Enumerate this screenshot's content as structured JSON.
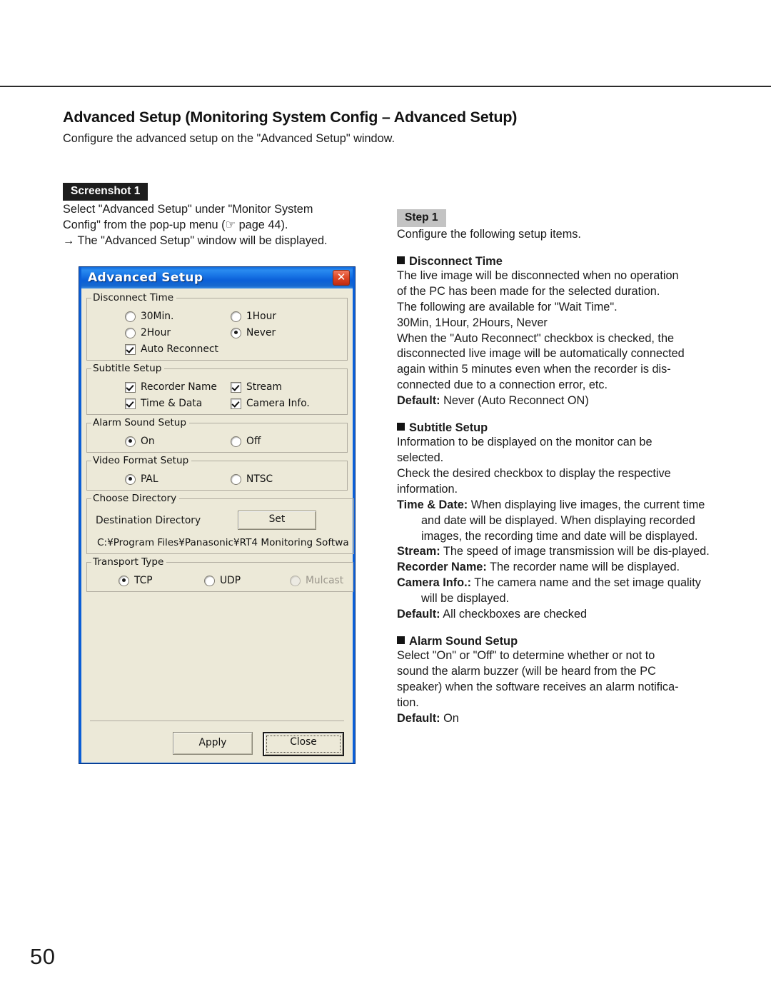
{
  "page": {
    "number": "50",
    "title": "Advanced Setup (Monitoring System Config – Advanced Setup)",
    "intro": "Configure the advanced setup on the \"Advanced Setup\" window."
  },
  "screenshot_section": {
    "badge": "Screenshot 1",
    "lines": [
      "Select \"Advanced Setup\" under \"Monitor System",
      "Config\" from the pop-up menu (☞ page 44).",
      "→ The \"Advanced Setup\" window will be displayed."
    ]
  },
  "step_section": {
    "badge": "Step 1",
    "intro": "Configure the following setup items.",
    "blocks": [
      {
        "heading": "Disconnect Time",
        "lines": [
          "The live image will be disconnected when no operation",
          "of the PC has been made for the selected duration.",
          "The following are available for \"Wait Time\".",
          "30Min, 1Hour, 2Hours, Never",
          "When the \"Auto Reconnect\" checkbox is checked, the",
          "disconnected live image will be automatically connected",
          "again within 5 minutes even when the recorder is dis-",
          "connected due to a connection error, etc."
        ],
        "default_label": "Default:",
        "default_value": "Never (Auto Reconnect ON)"
      },
      {
        "heading": "Subtitle Setup",
        "lines": [
          "Information to be displayed on the monitor can be",
          "selected.",
          "Check the desired checkbox to display the respective",
          "information."
        ],
        "definitions": [
          {
            "term": "Time & Date:",
            "text": "When displaying live images, the current time and date will be displayed. When displaying recorded images, the recording time and date will be displayed."
          },
          {
            "term": "Stream:",
            "text": "The speed of image transmission will be dis-played."
          },
          {
            "term": "Recorder Name:",
            "text": "The recorder name will be displayed."
          },
          {
            "term": "Camera Info.:",
            "text": "The camera name and the set image quality will be displayed."
          }
        ],
        "default_label": "Default:",
        "default_value": "All checkboxes are checked"
      },
      {
        "heading": "Alarm Sound Setup",
        "lines": [
          "Select \"On\" or \"Off\" to determine whether or not to",
          "sound the alarm buzzer (will be heard from the PC",
          "speaker) when the software receives an alarm notifica-",
          "tion."
        ],
        "default_label": "Default:",
        "default_value": "On"
      }
    ]
  },
  "dialog": {
    "title": "Advanced Setup",
    "close_icon": "✕",
    "groups": {
      "disconnect_time": {
        "legend": "Disconnect Time",
        "options": [
          {
            "label": "30Min.",
            "selected": false
          },
          {
            "label": "1Hour",
            "selected": false
          },
          {
            "label": "2Hour",
            "selected": false
          },
          {
            "label": "Never",
            "selected": true
          }
        ],
        "checkbox": {
          "label": "Auto Reconnect",
          "checked": true
        }
      },
      "subtitle_setup": {
        "legend": "Subtitle Setup",
        "checkboxes": [
          {
            "label": "Recorder Name",
            "checked": true
          },
          {
            "label": "Stream",
            "checked": true
          },
          {
            "label": "Time & Data",
            "checked": true
          },
          {
            "label": "Camera Info.",
            "checked": true
          }
        ]
      },
      "alarm_sound_setup": {
        "legend": "Alarm Sound Setup",
        "options": [
          {
            "label": "On",
            "selected": true
          },
          {
            "label": "Off",
            "selected": false
          }
        ]
      },
      "video_format_setup": {
        "legend": "Video Format Setup",
        "options": [
          {
            "label": "PAL",
            "selected": true
          },
          {
            "label": "NTSC",
            "selected": false
          }
        ]
      },
      "choose_directory": {
        "legend": "Choose Directory",
        "destination_label": "Destination Directory",
        "set_button": "Set",
        "path": "C:¥Program Files¥Panasonic¥RT4 Monitoring Softwa"
      },
      "transport_type": {
        "legend": "Transport Type",
        "options": [
          {
            "label": "TCP",
            "selected": true,
            "disabled": false
          },
          {
            "label": "UDP",
            "selected": false,
            "disabled": false
          },
          {
            "label": "Mulcast",
            "selected": false,
            "disabled": true
          }
        ]
      }
    },
    "buttons": {
      "apply": "Apply",
      "close": "Close"
    }
  },
  "colors": {
    "titlebar_blue": "#0b5fd8",
    "dialog_face": "#ece9d8",
    "close_red": "#e04a28",
    "badge_dark": "#1d1d1d",
    "badge_gray": "#c3c3c3"
  }
}
